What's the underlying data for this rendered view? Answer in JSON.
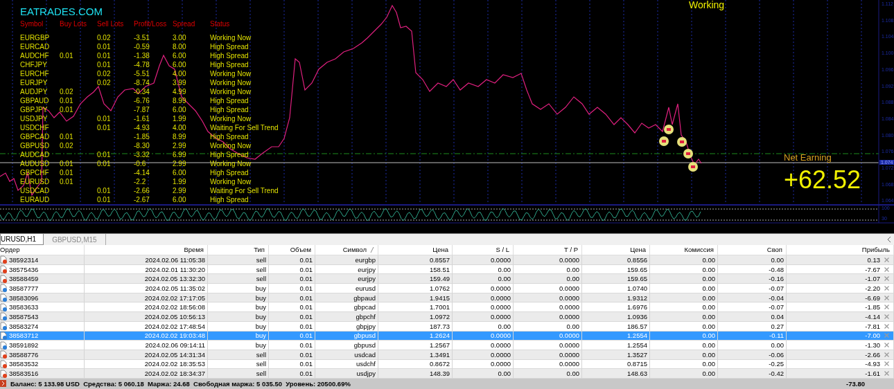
{
  "brand": "EATRADES.COM",
  "mode_label": "Working",
  "dashboard": {
    "columns": [
      "Symbol",
      "Buy Lots",
      "Sell Lots",
      "Profit/Loss",
      "Spread",
      "Status"
    ],
    "rows": [
      {
        "symbol": "EURGBP",
        "sell_lots": "0.02",
        "profit_loss": "-3.51",
        "spread": "3.00",
        "status": "Working Now"
      },
      {
        "symbol": "EURCAD",
        "sell_lots": "0.01",
        "profit_loss": "-0.59",
        "spread": "8.00",
        "status": "High Spread"
      },
      {
        "symbol": "AUDCHF",
        "buy_lots": "0.01",
        "sell_lots": "0.01",
        "profit_loss": "-1.38",
        "spread": "6.00",
        "status": "High Spread"
      },
      {
        "symbol": "CHFJPY",
        "sell_lots": "0.01",
        "profit_loss": "-4.78",
        "spread": "6.00",
        "status": "High Spread"
      },
      {
        "symbol": "EURCHF",
        "sell_lots": "0.02",
        "profit_loss": "-5.51",
        "spread": "4.00",
        "status": "Working Now"
      },
      {
        "symbol": "EURJPY",
        "sell_lots": "0.02",
        "profit_loss": "-8.74",
        "spread": "3.99",
        "status": "Working Now"
      },
      {
        "symbol": "AUDJPY",
        "buy_lots": "0.02",
        "profit_loss": "-0.34",
        "spread": "4.99",
        "status": "Working Now"
      },
      {
        "symbol": "GBPAUD",
        "buy_lots": "0.01",
        "profit_loss": "-6.76",
        "spread": "8.99",
        "status": "High Spread"
      },
      {
        "symbol": "GBPJPY",
        "buy_lots": "0.01",
        "profit_loss": "-7.87",
        "spread": "6.00",
        "status": "High Spread"
      },
      {
        "symbol": "USDJPY",
        "sell_lots": "0.01",
        "profit_loss": "-1.61",
        "spread": "1.99",
        "status": "Working Now"
      },
      {
        "symbol": "USDCHF",
        "sell_lots": "0.01",
        "profit_loss": "-4.93",
        "spread": "4.00",
        "status": "Waiting For Sell Trend"
      },
      {
        "symbol": "GBPCAD",
        "buy_lots": "0.01",
        "profit_loss": "-1.85",
        "spread": "8.99",
        "status": "High Spread"
      },
      {
        "symbol": "GBPUSD",
        "buy_lots": "0.02",
        "profit_loss": "-8.30",
        "spread": "2.99",
        "status": "Working Now"
      },
      {
        "symbol": "AUDCAD",
        "sell_lots": "0.01",
        "profit_loss": "-3.32",
        "spread": "6.99",
        "status": "High Spread"
      },
      {
        "symbol": "AUDUSD",
        "buy_lots": "0.01",
        "sell_lots": "0.01",
        "profit_loss": "-0.6",
        "spread": "2.99",
        "status": "Working Now"
      },
      {
        "symbol": "GBPCHF",
        "buy_lots": "0.01",
        "profit_loss": "-4.14",
        "spread": "6.00",
        "status": "High Spread"
      },
      {
        "symbol": "EURUSD",
        "buy_lots": "0.01",
        "profit_loss": "-2.2",
        "spread": "1.99",
        "status": "Working Now"
      },
      {
        "symbol": "USDCAD",
        "sell_lots": "0.01",
        "profit_loss": "-2.66",
        "spread": "2.99",
        "status": "Waiting For Sell Trend"
      },
      {
        "symbol": "EURAUD",
        "sell_lots": "0.01",
        "profit_loss": "-2.67",
        "spread": "6.00",
        "status": "High Spread"
      }
    ]
  },
  "net_earning": {
    "label": "Net Earning",
    "value": "+62.52"
  },
  "price_axis": [
    "1.112",
    "1.108",
    "1.104",
    "1.100",
    "1.096",
    "1.092",
    "1.088",
    "1.084",
    "1.080",
    "1.076",
    "1.072",
    "1.068",
    "1.064"
  ],
  "current_price": "1.074",
  "oscillator_axis": [
    "100",
    "30"
  ],
  "tabs": [
    {
      "label": "URUSD,H1",
      "selected": true
    },
    {
      "label": "GBPUSD,M15",
      "selected": false
    }
  ],
  "table": {
    "columns": [
      "Ордер",
      "Время",
      "Тип",
      "Объем",
      "Символ",
      "Цена",
      "S / L",
      "T / P",
      "Цена",
      "Комиссия",
      "Своп",
      "Прибыль"
    ],
    "rows": [
      {
        "kind": "sell",
        "selected": false,
        "cells": [
          "38592314",
          "2024.02.06 11:05:38",
          "sell",
          "0.01",
          "eurgbp",
          "0.8557",
          "0.0000",
          "0.0000",
          "0.8556",
          "0.00",
          "0.00",
          "0.13"
        ]
      },
      {
        "kind": "sell",
        "selected": false,
        "cells": [
          "38575436",
          "2024.02.01 11:30:20",
          "sell",
          "0.01",
          "eurjpy",
          "158.51",
          "0.00",
          "0.00",
          "159.65",
          "0.00",
          "-0.48",
          "-7.67"
        ]
      },
      {
        "kind": "sell",
        "selected": false,
        "cells": [
          "38588459",
          "2024.02.05 13:32:30",
          "sell",
          "0.01",
          "eurjpy",
          "159.49",
          "0.00",
          "0.00",
          "159.65",
          "0.00",
          "-0.16",
          "-1.07"
        ]
      },
      {
        "kind": "buy",
        "selected": false,
        "cells": [
          "38587777",
          "2024.02.05 11:35:02",
          "buy",
          "0.01",
          "eurusd",
          "1.0762",
          "0.0000",
          "0.0000",
          "1.0740",
          "0.00",
          "-0.07",
          "-2.20"
        ]
      },
      {
        "kind": "buy",
        "selected": false,
        "cells": [
          "38583096",
          "2024.02.02 17:17:05",
          "buy",
          "0.01",
          "gbpaud",
          "1.9415",
          "0.0000",
          "0.0000",
          "1.9312",
          "0.00",
          "-0.04",
          "-6.69"
        ]
      },
      {
        "kind": "buy",
        "selected": false,
        "cells": [
          "38583633",
          "2024.02.02 18:56:08",
          "buy",
          "0.01",
          "gbpcad",
          "1.7001",
          "0.0000",
          "0.0000",
          "1.6976",
          "0.00",
          "-0.07",
          "-1.85"
        ]
      },
      {
        "kind": "buy",
        "selected": false,
        "cells": [
          "38587543",
          "2024.02.05 10:56:13",
          "buy",
          "0.01",
          "gbpchf",
          "1.0972",
          "0.0000",
          "0.0000",
          "1.0936",
          "0.00",
          "0.04",
          "-4.14"
        ]
      },
      {
        "kind": "buy",
        "selected": false,
        "cells": [
          "38583274",
          "2024.02.02 17:48:54",
          "buy",
          "0.01",
          "gbpjpy",
          "187.73",
          "0.00",
          "0.00",
          "186.57",
          "0.00",
          "0.27",
          "-7.81"
        ]
      },
      {
        "kind": "buy",
        "selected": true,
        "cells": [
          "38583712",
          "2024.02.02 19:03:48",
          "buy",
          "0.01",
          "gbpusd",
          "1.2624",
          "0.0000",
          "0.0000",
          "1.2554",
          "0.00",
          "-0.11",
          "-7.00"
        ]
      },
      {
        "kind": "buy",
        "selected": false,
        "cells": [
          "38591892",
          "2024.02.06 09:14:11",
          "buy",
          "0.01",
          "gbpusd",
          "1.2567",
          "0.0000",
          "0.0000",
          "1.2554",
          "0.00",
          "0.00",
          "-1.30"
        ]
      },
      {
        "kind": "sell",
        "selected": false,
        "cells": [
          "38588776",
          "2024.02.05 14:31:34",
          "sell",
          "0.01",
          "usdcad",
          "1.3491",
          "0.0000",
          "0.0000",
          "1.3527",
          "0.00",
          "-0.06",
          "-2.66"
        ]
      },
      {
        "kind": "sell",
        "selected": false,
        "cells": [
          "38583532",
          "2024.02.02 18:35:53",
          "sell",
          "0.01",
          "usdchf",
          "0.8672",
          "0.0000",
          "0.0000",
          "0.8715",
          "0.00",
          "-0.25",
          "-4.93"
        ]
      },
      {
        "kind": "sell",
        "selected": false,
        "cells": [
          "38583516",
          "2024.02.02 18:34:37",
          "sell",
          "0.01",
          "usdjpy",
          "148.39",
          "0.00",
          "0.00",
          "148.63",
          "0.00",
          "-0.42",
          "-1.61"
        ]
      }
    ]
  },
  "status_bar": {
    "summary": "Баланс: 5 133.98 USD  Средства: 5 060.18  Маржа: 24.68  Свободная маржа: 5 035.50  Уровень: 20500.69%",
    "total": "-73.80"
  }
}
